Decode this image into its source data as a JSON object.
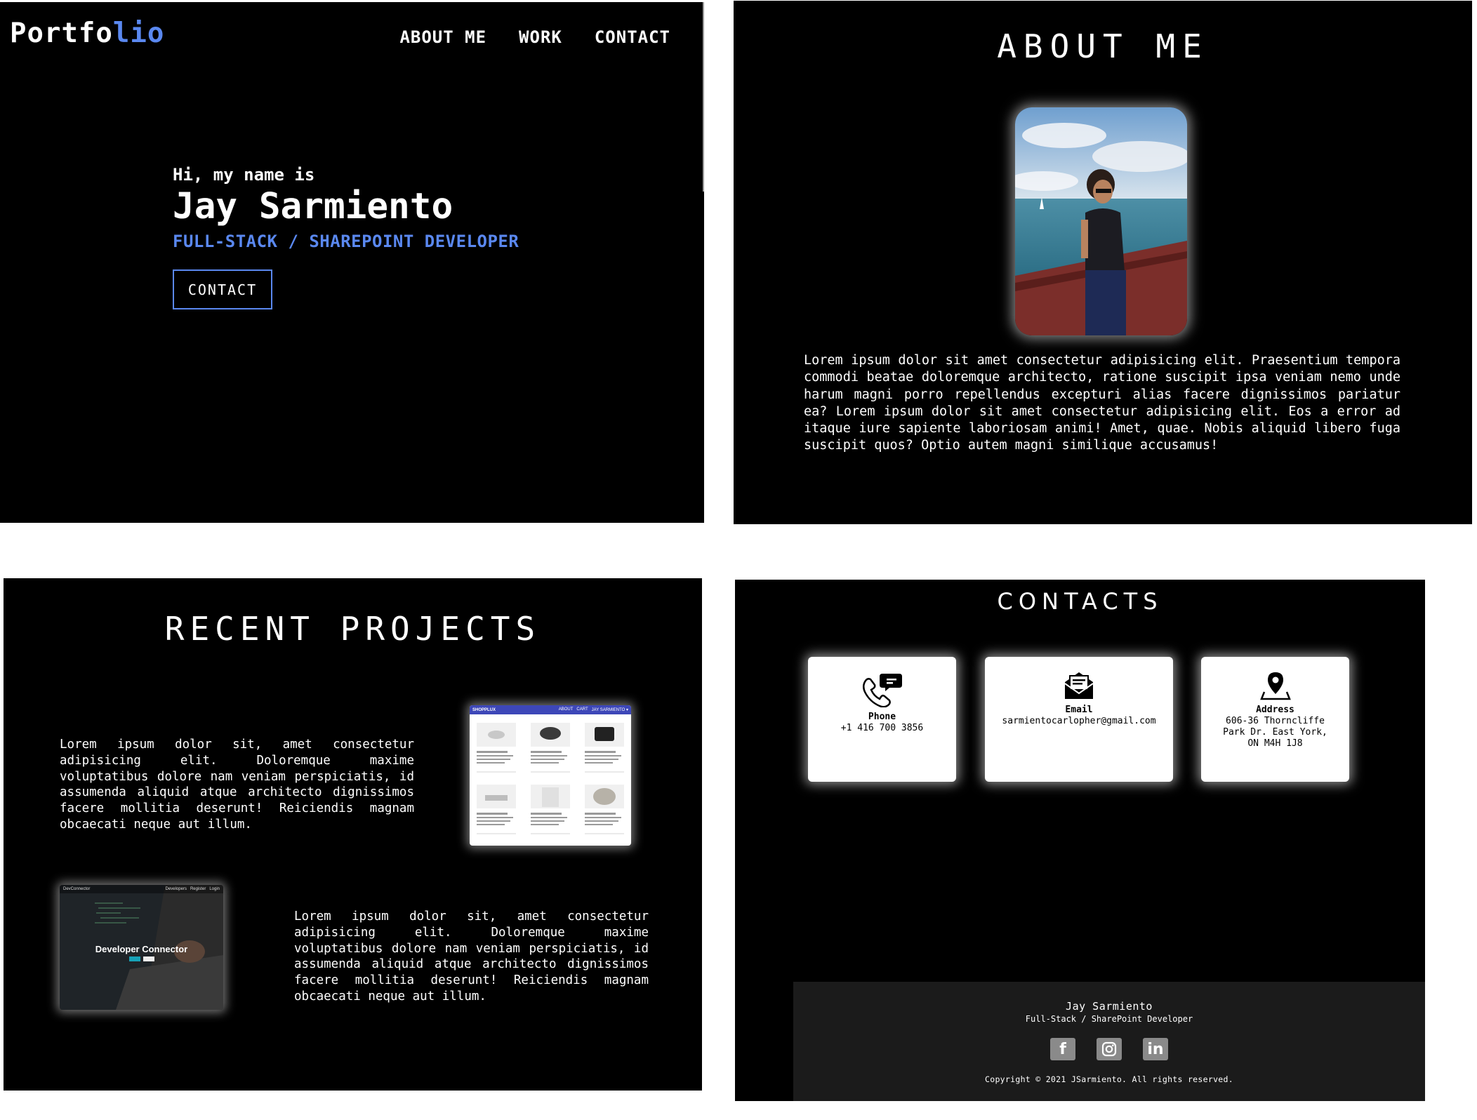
{
  "hero": {
    "logo_main": "Portfo",
    "logo_accent": "lio",
    "nav": [
      "ABOUT ME",
      "WORK",
      "CONTACT"
    ],
    "greeting": "Hi, my name is",
    "name": "Jay Sarmiento",
    "role": "FULL-STACK / SHAREPOINT DEVELOPER",
    "button": "CONTACT"
  },
  "about": {
    "title": "ABOUT ME",
    "text": "Lorem ipsum dolor sit amet consectetur adipisicing elit. Praesentium tempora commodi beatae doloremque architecto, ratione suscipit ipsa veniam nemo unde harum magni porro repellendus excepturi alias facere dignissimos pariatur ea? Lorem ipsum dolor sit amet consectetur adipisicing elit. Eos a error ad itaque iure sapiente laboriosam animi! Amet, quae. Nobis aliquid libero fuga suscipit quos? Optio autem magni similique accusamus!"
  },
  "projects": {
    "title": "RECENT PROJECTS",
    "items": [
      {
        "text": "Lorem ipsum dolor sit, amet consectetur adipisicing elit. Doloremque maxime voluptatibus dolore nam veniam perspiciatis, id assumenda aliquid atque architecto dignissimos facere mollitia deserunt! Reiciendis magnam obcaecati neque aut illum.",
        "shot": {
          "brand": "SHOPPLUX",
          "nav": [
            "ABOUT",
            "CART",
            "JAY SARMIENTO ▾"
          ]
        }
      },
      {
        "text": "Lorem ipsum dolor sit, amet consectetur adipisicing elit. Doloremque maxime voluptatibus dolore nam veniam perspiciatis, id assumenda aliquid atque architecto dignissimos facere mollitia deserunt! Reiciendis magnam obcaecati neque aut illum.",
        "shot": {
          "brand": "DevConnector",
          "nav": [
            "Developers",
            "Register",
            "Login"
          ],
          "heading": "Developer Connector"
        }
      }
    ]
  },
  "contacts": {
    "title": "CONTACTS",
    "cards": [
      {
        "label": "Phone",
        "value": "+1 416 700 3856"
      },
      {
        "label": "Email",
        "value": "sarmientocarlopher@gmail.com"
      },
      {
        "label": "Address",
        "value": "606-36 Thorncliffe Park Dr. East York, ON M4H 1J8"
      }
    ],
    "footer": {
      "name": "Jay Sarmiento",
      "role": "Full-Stack / SharePoint Developer",
      "copyright": "Copyright © 2021 JSarmiento. All rights reserved.",
      "socials": [
        "facebook-icon",
        "instagram-icon",
        "linkedin-icon"
      ]
    }
  },
  "colors": {
    "accent": "#5a88f0",
    "background": "#000000",
    "footer": "#1b1b1b"
  }
}
